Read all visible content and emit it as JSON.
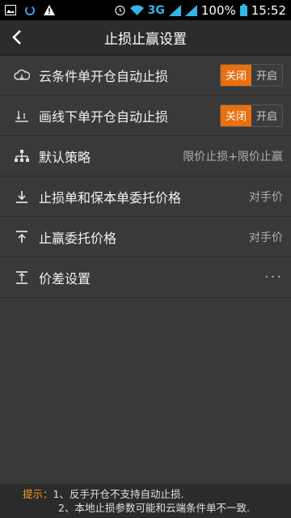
{
  "status_bar": {
    "network": "3G",
    "battery": "100%",
    "time": "15:52"
  },
  "header": {
    "title": "止损止赢设置"
  },
  "settings": [
    {
      "label": "云条件单开仓自动止损",
      "type": "toggle",
      "on_label": "关闭",
      "off_label": "开启",
      "selected": "关闭",
      "icon": "cloud-icon"
    },
    {
      "label": "画线下单开仓自动止损",
      "type": "toggle",
      "on_label": "关闭",
      "off_label": "开启",
      "selected": "关闭",
      "icon": "draw-line-icon"
    },
    {
      "label": "默认策略",
      "type": "value",
      "value": "限价止损+限价止赢",
      "icon": "hierarchy-icon"
    },
    {
      "label": "止损单和保本单委托价格",
      "type": "value",
      "value": "对手价",
      "icon": "arrow-down-icon"
    },
    {
      "label": "止赢委托价格",
      "type": "value",
      "value": "对手价",
      "icon": "arrow-up-icon"
    },
    {
      "label": "价差设置",
      "type": "more",
      "value": "···",
      "icon": "spread-icon"
    }
  ],
  "tips": {
    "label": "提示：",
    "lines": [
      "1、反手开仓不支持自动止损.",
      "2、本地止损参数可能和云端条件单不一致."
    ]
  },
  "colors": {
    "accent": "#e8700f",
    "background": "#393939",
    "tip_label": "#f0a020"
  }
}
